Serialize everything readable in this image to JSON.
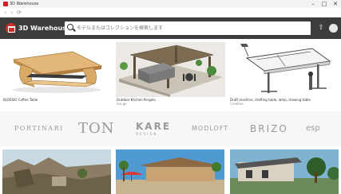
{
  "window": {
    "title": "3D Warehouse",
    "minimize": "–",
    "maximize": "□",
    "close": "✕"
  },
  "browser": {
    "back": "‹",
    "forward": "›",
    "reload": "⟳"
  },
  "header": {
    "brand": "3D Warehouse",
    "search_placeholder": "モデルまたはコレクションを検索します",
    "upload_icon": "upload-icon",
    "avatar_icon": "user-avatar"
  },
  "models": [
    {
      "title": "BLOSSIO Coffee Table",
      "author": ""
    },
    {
      "title": "Outdoor Kitchen Pergola",
      "author": "mu.ge"
    },
    {
      "title": "Draft machine, drafting table, lamp, drawing table",
      "author": "Creative"
    }
  ],
  "brands": [
    "PORTINARI",
    "TON",
    "KARE",
    "MODLOFT",
    "BRIZO",
    "esp"
  ],
  "brand_sub": {
    "kare": "DESIGN"
  },
  "colors": {
    "header_bg": "#3c3c3c",
    "brand_red": "#d42b2b"
  }
}
